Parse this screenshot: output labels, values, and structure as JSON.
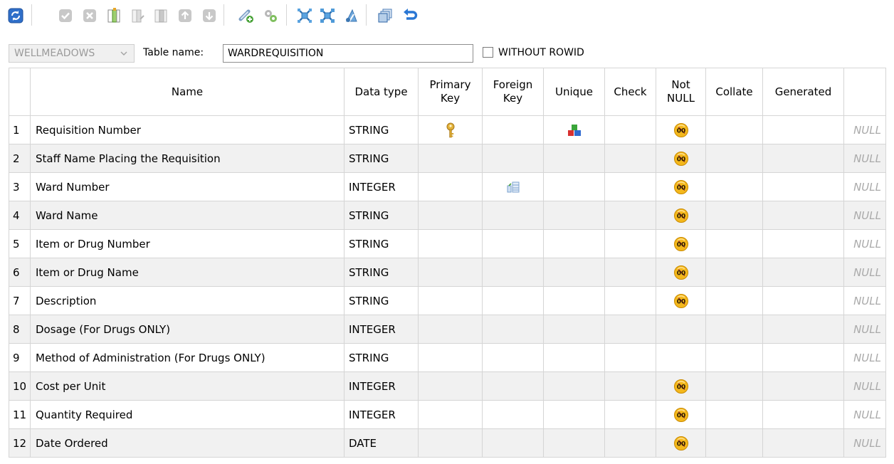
{
  "toolbar": {
    "buttons": [
      {
        "icon": "refresh-icon"
      },
      {
        "icon": "commit-icon"
      },
      {
        "icon": "rollback-icon"
      },
      {
        "icon": "add-column-icon"
      },
      {
        "icon": "edit-column-icon"
      },
      {
        "icon": "delete-column-icon"
      },
      {
        "icon": "move-up-icon"
      },
      {
        "icon": "move-down-icon"
      },
      {
        "icon": "add-constraint-icon"
      },
      {
        "icon": "edit-constraint-icon"
      },
      {
        "icon": "primary-key-icon"
      },
      {
        "icon": "foreign-key-icon"
      },
      {
        "icon": "check-constraint-icon"
      },
      {
        "icon": "copy-icon"
      },
      {
        "icon": "undo-icon"
      }
    ]
  },
  "form": {
    "database": "WELLMEADOWS",
    "table_name_label": "Table name:",
    "table_name_value": "WARDREQUISITION",
    "without_rowid_label": "WITHOUT ROWID",
    "without_rowid_checked": false
  },
  "grid": {
    "headers": {
      "num": "",
      "name": "Name",
      "data_type": "Data type",
      "primary_key": [
        "Primary",
        "Key"
      ],
      "foreign_key": [
        "Foreign",
        "Key"
      ],
      "unique": "Unique",
      "check": "Check",
      "not_null": [
        "Not",
        "NULL"
      ],
      "collate": "Collate",
      "generated": "Generated",
      "default": ""
    },
    "rows": [
      {
        "num": "1",
        "name": "Requisition Number",
        "type": "STRING",
        "pk": true,
        "fk": false,
        "unique": true,
        "notnull": true,
        "default": "NULL"
      },
      {
        "num": "2",
        "name": "Staff Name Placing the Requisition",
        "type": "STRING",
        "pk": false,
        "fk": false,
        "unique": false,
        "notnull": true,
        "default": "NULL"
      },
      {
        "num": "3",
        "name": "Ward Number",
        "type": "INTEGER",
        "pk": false,
        "fk": true,
        "unique": false,
        "notnull": true,
        "default": "NULL"
      },
      {
        "num": "4",
        "name": "Ward Name",
        "type": "STRING",
        "pk": false,
        "fk": false,
        "unique": false,
        "notnull": true,
        "default": "NULL"
      },
      {
        "num": "5",
        "name": "Item or Drug Number",
        "type": "STRING",
        "pk": false,
        "fk": false,
        "unique": false,
        "notnull": true,
        "default": "NULL"
      },
      {
        "num": "6",
        "name": "Item or Drug Name",
        "type": "STRING",
        "pk": false,
        "fk": false,
        "unique": false,
        "notnull": true,
        "default": "NULL"
      },
      {
        "num": "7",
        "name": "Description",
        "type": "STRING",
        "pk": false,
        "fk": false,
        "unique": false,
        "notnull": true,
        "default": "NULL"
      },
      {
        "num": "8",
        "name": "Dosage (For Drugs ONLY)",
        "type": "INTEGER",
        "pk": false,
        "fk": false,
        "unique": false,
        "notnull": false,
        "default": "NULL"
      },
      {
        "num": "9",
        "name": " Method of Administration (For Drugs ONLY)",
        "type": "STRING",
        "pk": false,
        "fk": false,
        "unique": false,
        "notnull": false,
        "default": "NULL"
      },
      {
        "num": "10",
        "name": "Cost per Unit",
        "type": "INTEGER",
        "pk": false,
        "fk": false,
        "unique": false,
        "notnull": true,
        "default": "NULL"
      },
      {
        "num": "11",
        "name": "Quantity Required",
        "type": "INTEGER",
        "pk": false,
        "fk": false,
        "unique": false,
        "notnull": true,
        "default": "NULL"
      },
      {
        "num": "12",
        "name": "Date Ordered",
        "type": "DATE",
        "pk": false,
        "fk": false,
        "unique": false,
        "notnull": true,
        "default": "NULL"
      }
    ]
  },
  "colors": {
    "accent_blue": "#2f6fc9",
    "grid_border": "#d5d5d5",
    "row_alt": "#f1f1f1",
    "null_text": "#aaaaaa"
  }
}
